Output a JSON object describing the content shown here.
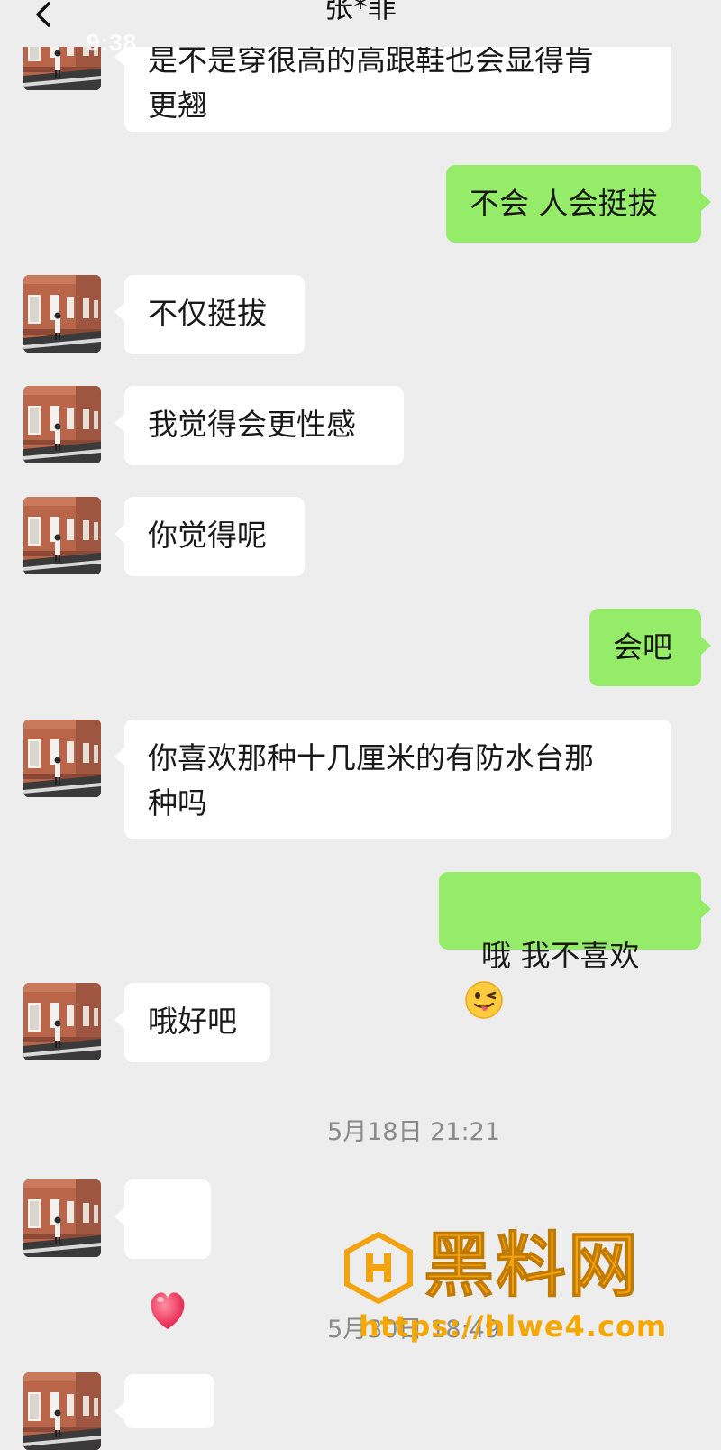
{
  "status": {
    "time": "9:38"
  },
  "header": {
    "title": "张*菲"
  },
  "messages": {
    "m1": "是不是穿很高的高跟鞋也会显得肯\n更翘",
    "m2": "不会 人会挺拔",
    "m3": "不仅挺拔",
    "m4": "我觉得会更性感",
    "m5": "你觉得呢",
    "m6": "会吧",
    "m7": "你喜欢那种十几厘米的有防水台那\n种吗",
    "m8": "哦 我不喜欢",
    "m9": "哦好吧"
  },
  "timestamps": {
    "t1": "5月18日 21:21",
    "t2": "5月30日 18:49"
  },
  "icons": {
    "back": "chevron-left-icon",
    "heart": "heart-icon",
    "wink": "wink-tongue-emoji"
  },
  "watermark": {
    "brand": "黑料网",
    "url": "https://hlwe4.com"
  },
  "colors": {
    "bg": "#ededed",
    "outgoing": "#95ec69",
    "incoming": "#ffffff",
    "watermark": "#f2a30f"
  }
}
